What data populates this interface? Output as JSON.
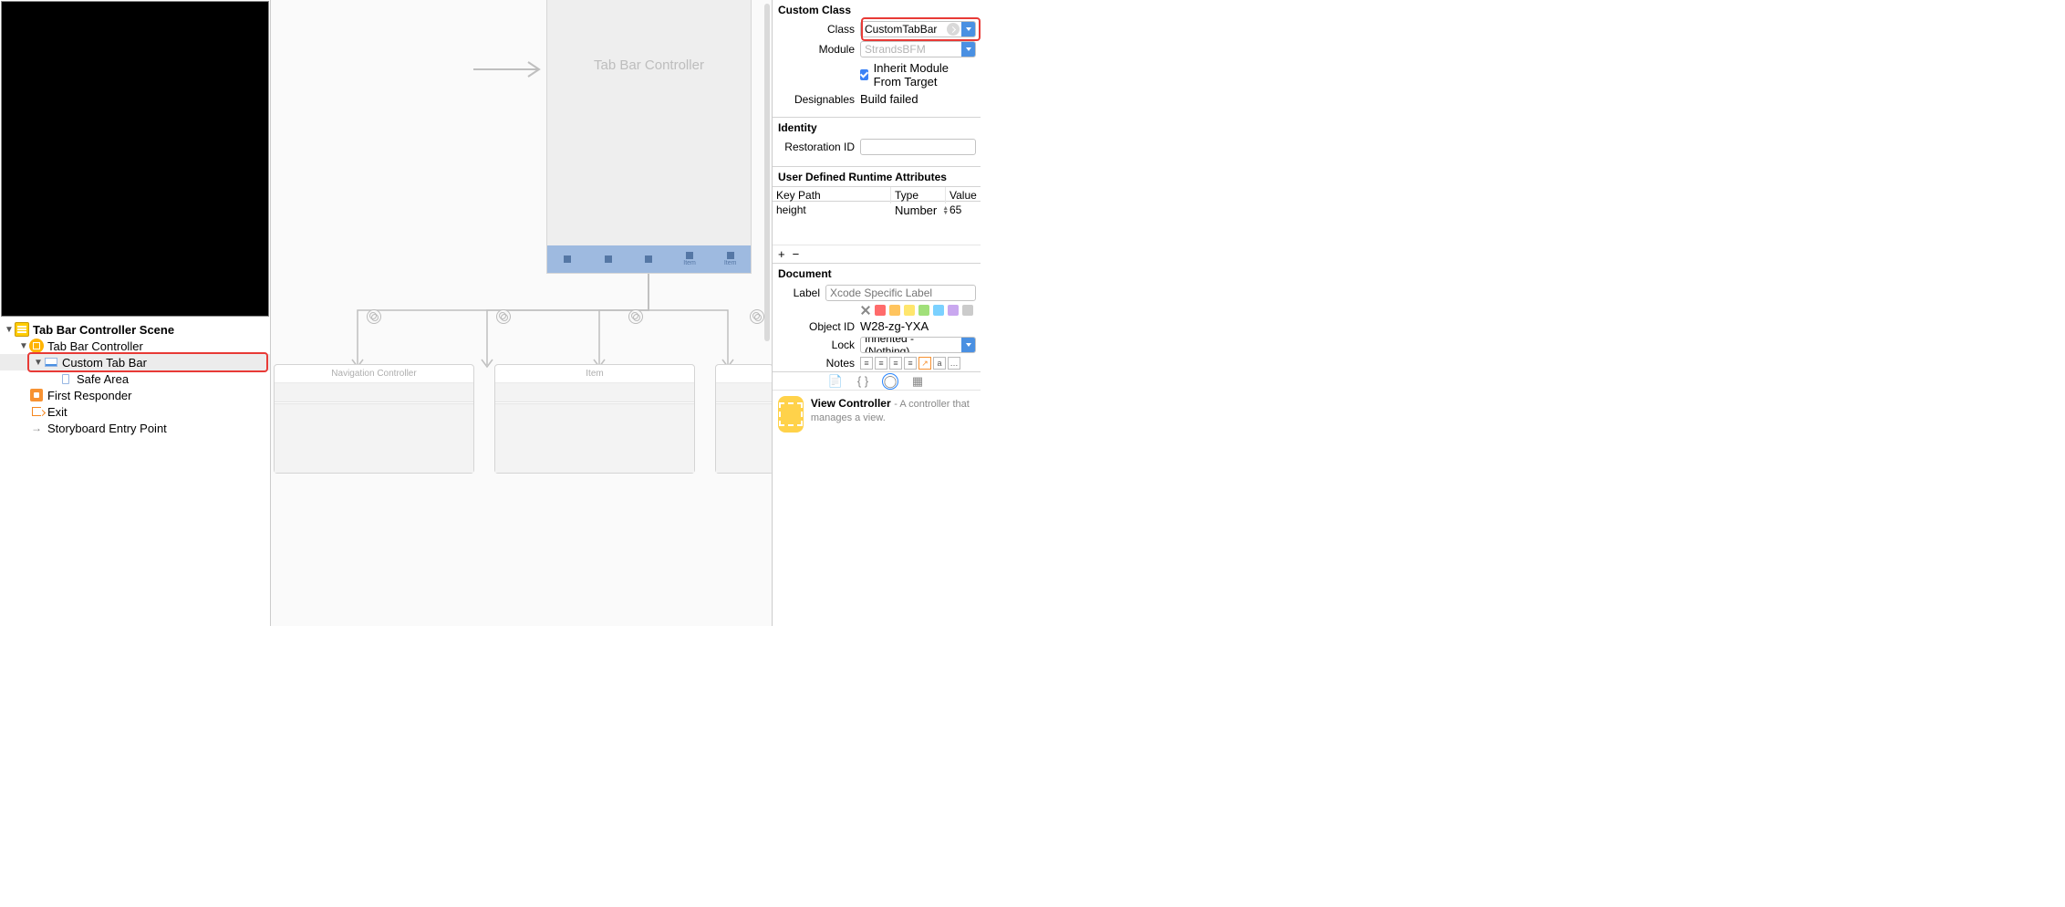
{
  "outline": {
    "scene": "Tab Bar Controller Scene",
    "controller": "Tab Bar Controller",
    "custom_tab_bar": "Custom Tab Bar",
    "safe_area": "Safe Area",
    "first_responder": "First Responder",
    "exit": "Exit",
    "entry_point": "Storyboard Entry Point"
  },
  "canvas": {
    "phone_title": "Tab Bar Controller",
    "tab_item_label": "Item",
    "dest_nav": "Navigation Controller",
    "dest_item": "Item"
  },
  "inspector": {
    "custom_class": {
      "header": "Custom Class",
      "class_label": "Class",
      "class_value": "CustomTabBar",
      "module_label": "Module",
      "module_placeholder": "StrandsBFM",
      "inherit_label": "Inherit Module From Target",
      "designables_label": "Designables",
      "designables_value": "Build failed"
    },
    "identity": {
      "header": "Identity",
      "restoration_label": "Restoration ID"
    },
    "udra": {
      "header": "User Defined Runtime Attributes",
      "col_key": "Key Path",
      "col_type": "Type",
      "col_value": "Value",
      "row_key": "height",
      "row_type": "Number",
      "row_value": "65",
      "add": "+",
      "remove": "−"
    },
    "document": {
      "header": "Document",
      "label_label": "Label",
      "label_placeholder": "Xcode Specific Label",
      "object_id_label": "Object ID",
      "object_id_value": "W28-zg-YXA",
      "lock_label": "Lock",
      "lock_value": "Inherited - (Nothing)",
      "notes_label": "Notes"
    },
    "library": {
      "title": "View Controller",
      "subtitle": "- A controller that manages a view."
    }
  }
}
